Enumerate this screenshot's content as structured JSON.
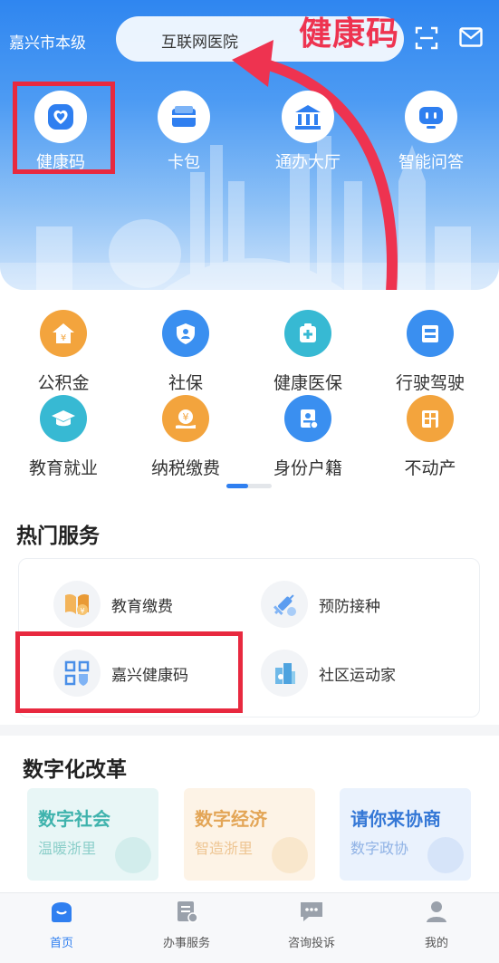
{
  "header": {
    "city": "嘉兴市本级",
    "search_text": "互联网医院",
    "overlay_title": "健康码"
  },
  "quick_actions": [
    {
      "label": "健康码",
      "icon": "heart-shield-icon"
    },
    {
      "label": "卡包",
      "icon": "card-wallet-icon"
    },
    {
      "label": "通办大厅",
      "icon": "government-hall-icon"
    },
    {
      "label": "智能问答",
      "icon": "robot-chat-icon"
    }
  ],
  "services": [
    {
      "label": "公积金",
      "icon": "housing-fund-icon",
      "color": "#f3a43d"
    },
    {
      "label": "社保",
      "icon": "social-security-icon",
      "color": "#3a8ff0"
    },
    {
      "label": "健康医保",
      "icon": "medical-insurance-icon",
      "color": "#37b9d3"
    },
    {
      "label": "行驶驾驶",
      "icon": "driving-license-icon",
      "color": "#3a8ff0"
    },
    {
      "label": "教育就业",
      "icon": "graduation-cap-icon",
      "color": "#37b9d3"
    },
    {
      "label": "纳税缴费",
      "icon": "tax-payment-icon",
      "color": "#f3a43d"
    },
    {
      "label": "身份户籍",
      "icon": "identity-icon",
      "color": "#3a8ff0"
    },
    {
      "label": "不动产",
      "icon": "real-estate-icon",
      "color": "#f3a43d"
    }
  ],
  "hot": {
    "title": "热门服务",
    "items": [
      {
        "label": "教育缴费",
        "icon": "education-payment-icon"
      },
      {
        "label": "预防接种",
        "icon": "vaccine-syringe-icon"
      },
      {
        "label": "嘉兴健康码",
        "icon": "qr-health-code-icon"
      },
      {
        "label": "社区运动家",
        "icon": "community-sports-icon"
      }
    ]
  },
  "reform": {
    "title": "数字化改革",
    "cards": [
      {
        "title": "数字社会",
        "subtitle": "温暖浙里",
        "bg": "#e8f6f6",
        "color": "#3fb3ad"
      },
      {
        "title": "数字经济",
        "subtitle": "智造浙里",
        "bg": "#fdf3e6",
        "color": "#e3a556"
      },
      {
        "title": "请你来协商",
        "subtitle": "数字政协",
        "bg": "#eaf2fd",
        "color": "#3578d6"
      }
    ]
  },
  "tabs": [
    {
      "label": "首页",
      "icon": "home-icon"
    },
    {
      "label": "办事服务",
      "icon": "service-doc-icon"
    },
    {
      "label": "咨询投诉",
      "icon": "chat-bubble-icon"
    },
    {
      "label": "我的",
      "icon": "user-icon"
    }
  ],
  "colors": {
    "accent": "#2f7ff0",
    "highlight_red": "#e8293f"
  }
}
